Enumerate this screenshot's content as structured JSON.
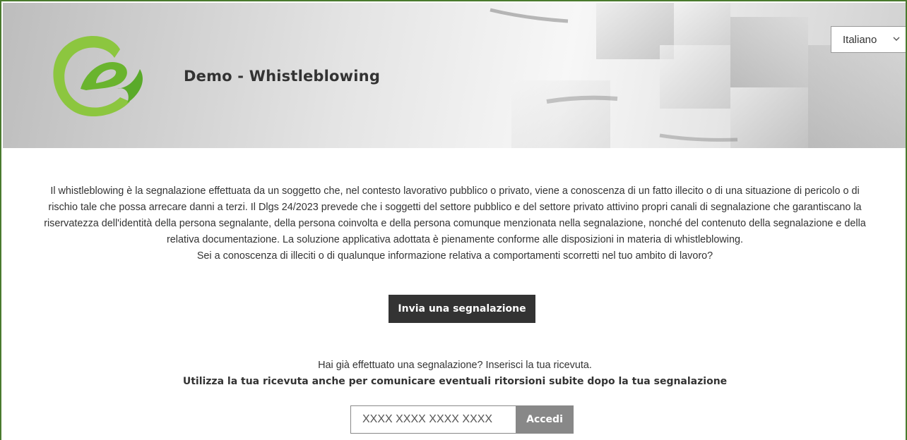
{
  "header": {
    "site_title": "Demo - Whistleblowing",
    "logo_icon": "e-logo-icon",
    "logo_colors": [
      "#8cc63f",
      "#5aaa2a"
    ],
    "language": {
      "selected": "Italiano",
      "chevron_icon": "chevron-down-icon"
    }
  },
  "intro": {
    "paragraph": "Il whistleblowing è la segnalazione effettuata da un soggetto che, nel contesto lavorativo pubblico o privato, viene a conoscenza di un fatto illecito o di una situazione di pericolo o di rischio tale che possa arrecare danni a terzi. Il Dlgs 24/2023 prevede che i soggetti del settore pubblico e del settore privato attivino propri canali di segnalazione che garantiscano la riservatezza dell'identità della persona segnalante, della persona coinvolta e della persona comunque menzionata nella segnalazione, nonché del contenuto della segnalazione e della relativa documentazione. La soluzione applicativa adottata è pienamente conforme alle disposizioni in materia di whistleblowing.",
    "question": "Sei a conoscenza di illeciti o di qualunque informazione relativa a comportamenti scorretti nel tuo ambito di lavoro?"
  },
  "actions": {
    "send_report_label": "Invia una segnalazione"
  },
  "receipt": {
    "question": "Hai già effettuato una segnalazione? Inserisci la tua ricevuta.",
    "note": "Utilizza la tua ricevuta anche per comunicare eventuali ritorsioni subite dopo la tua segnalazione",
    "input_value": "",
    "input_placeholder": "XXXX XXXX XXXX XXXX",
    "submit_label": "Accedi"
  },
  "colors": {
    "frame_border": "#4a7a2e",
    "primary_button": "#333333",
    "secondary_button": "#888888"
  }
}
